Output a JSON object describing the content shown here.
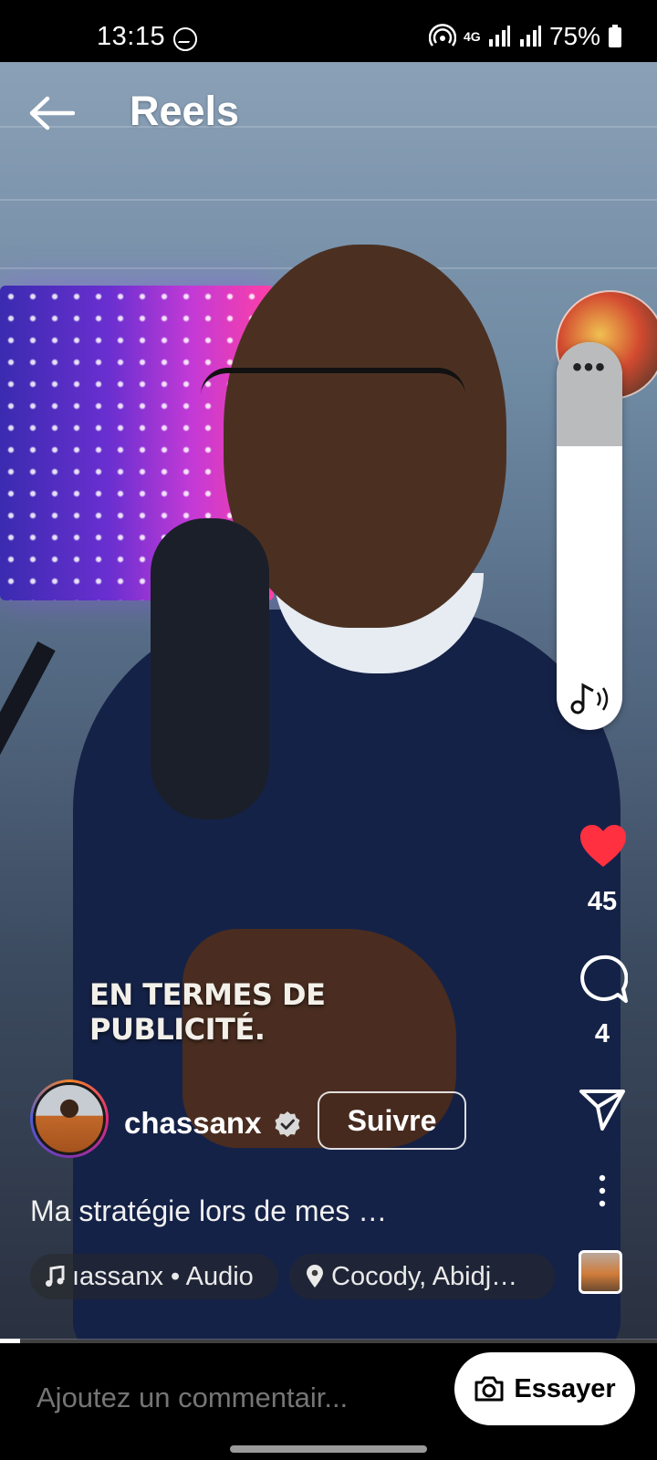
{
  "status_bar": {
    "time": "13:15",
    "network": "4G",
    "battery": "75%",
    "icons": [
      "messenger-icon",
      "hotspot-icon",
      "signal-icon",
      "battery-icon"
    ]
  },
  "header": {
    "title": "Reels",
    "back_icon": "arrow-left-icon"
  },
  "video": {
    "caption_overlay_line1": "EN TERMES DE",
    "caption_overlay_line2": "PUBLICITÉ."
  },
  "volume_panel": {
    "more_label": "•••",
    "level": 0.75
  },
  "actions": {
    "like_count": "45",
    "comment_count": "4",
    "like_color": "#ff3040"
  },
  "author": {
    "username": "chassanx",
    "verified": true,
    "follow_label": "Suivre"
  },
  "description": "Ma stratégie lors de mes …",
  "audio": {
    "label": "ıassanx • Audio"
  },
  "location": {
    "label": "Cocody, Abidj…"
  },
  "progress": 0.03,
  "comment_bar": {
    "placeholder": "Ajoutez un commentair...",
    "try_label": "Essayer"
  }
}
